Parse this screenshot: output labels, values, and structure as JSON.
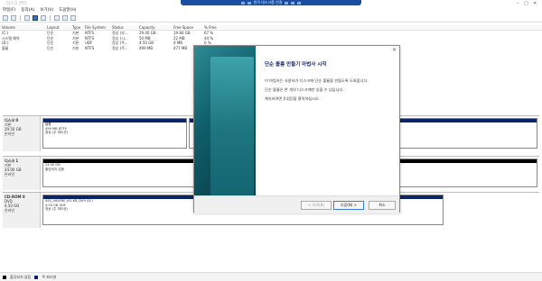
{
  "window": {
    "title": "디스크 관리"
  },
  "remote_bar": {
    "title": "원격 데스크톱 연결"
  },
  "menu": {
    "items": [
      "파일(F)",
      "동작(A)",
      "보기(V)",
      "도움말(H)"
    ]
  },
  "volumes": {
    "headers": [
      "Volume",
      "Layout",
      "Type",
      "File System",
      "Status",
      "Capacity",
      "Free Space",
      "% Free"
    ],
    "rows": [
      [
        "(C:)",
        "단순",
        "기본",
        "NTFS",
        "정상 (부...",
        "29.40 GB",
        "19.84 GB",
        "67 %"
      ],
      [
        "시스템 예약",
        "단순",
        "기본",
        "NTFS",
        "정상 (시...",
        "50 MB",
        "22 MB",
        "44 %"
      ],
      [
        "(D:)",
        "단순",
        "기본",
        "UDF",
        "정상 (주...",
        "4.50 GB",
        "0 MB",
        "0 %"
      ],
      [
        "볼륨",
        "단순",
        "기본",
        "NTFS",
        "정상 (주...",
        "499 MB",
        "477 MB",
        "96 %"
      ]
    ]
  },
  "disks": [
    {
      "name": "디스크 0",
      "type": "기본",
      "size": "29.50 GB",
      "status": "온라인",
      "partitions": [
        {
          "label": "볼륨",
          "size": "499 MB NTFS",
          "status": "정상 (주 파티션)"
        },
        {
          "label": "",
          "size": "",
          "status": ""
        }
      ]
    },
    {
      "name": "디스크 1",
      "type": "기본",
      "size": "24.00 GB",
      "status": "온라인",
      "partitions": [
        {
          "label": "",
          "size": "24.00 GB",
          "status": "할당되지 않음"
        }
      ]
    },
    {
      "name": "CD-ROM 0",
      "type": "DVD",
      "size": "4.50 GB",
      "status": "온라인",
      "partitions": [
        {
          "label": "SSS_X64FRE_KO-KR_DV9 (D:)",
          "size": "4.50 GB UDF",
          "status": "정상 (주 파티션)"
        }
      ]
    }
  ],
  "status_legend": [
    {
      "label": "할당되지 않음",
      "color": "#000000"
    },
    {
      "label": "주 파티션",
      "color": "#0a246a"
    }
  ],
  "wizard": {
    "title": "단순 볼륨 만들기 마법사 시작",
    "para1": "이 마법사는 사용자가 디스크에 단순 볼륨을 만들도록 도와줍니다.",
    "para2": "단순 볼륨은 한 개의 디스크에만 있을 수 있습니다.",
    "para3": "계속하려면 [다음]을 클릭하십시오.",
    "back_label": "< 뒤로(B)",
    "next_label": "다음(N) >",
    "cancel_label": "취소"
  }
}
